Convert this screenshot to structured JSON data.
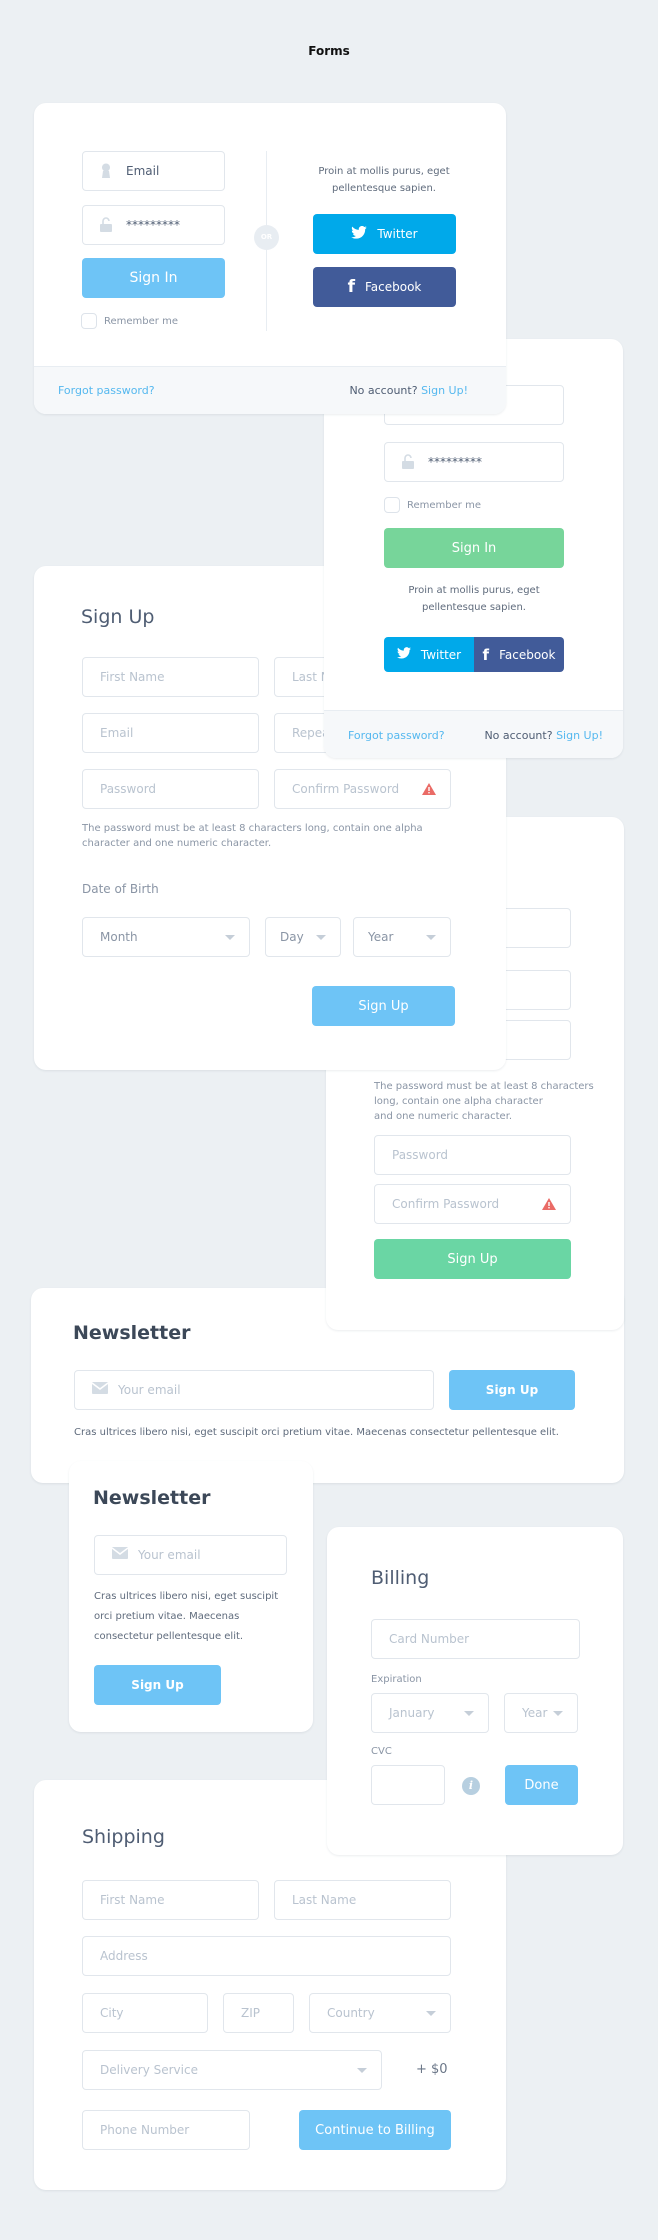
{
  "page": {
    "title": "Forms"
  },
  "colors": {
    "accent_blue": "#6ec4f6",
    "green": "#77d59a",
    "twitter": "#00a9ea",
    "facebook": "#415b99",
    "link": "#55b8ef",
    "warning": "#ea6b66"
  },
  "login_wide": {
    "email_value": "Email",
    "password_value": "*********",
    "sign_in": "Sign In",
    "remember_me": "Remember me",
    "or": "OR",
    "social_text": "Proin at mollis purus, eget pellentesque sapien.",
    "twitter": "Twitter",
    "facebook": "Facebook",
    "forgot": "Forgot password?",
    "no_account": "No account?",
    "sign_up_link": "Sign Up!"
  },
  "login_narrow": {
    "password_value": "*********",
    "remember_me": "Remember me",
    "sign_in": "Sign In",
    "social_text": "Proin at mollis purus, eget pellentesque sapien.",
    "twitter": "Twitter",
    "facebook": "Facebook",
    "forgot": "Forgot password?",
    "no_account": "No account?",
    "sign_up_link": "Sign Up!"
  },
  "signup_wide": {
    "title": "Sign Up",
    "first_name": "First Name",
    "last_name": "Last Name",
    "email": "Email",
    "repeat_email": "Repeat Email",
    "password": "Password",
    "confirm_password": "Confirm Password",
    "hint": "The password must be at least 8 characters long, contain one alpha character and one numeric character.",
    "dob_label": "Date of Birth",
    "month": "Month",
    "day": "Day",
    "year": "Year",
    "submit": "Sign Up"
  },
  "signup_narrow": {
    "hint_line1": "The password must be at least 8 characters",
    "hint_line2": "long, contain one alpha character",
    "hint_line3": "and one numeric character.",
    "password": "Password",
    "confirm_password": "Confirm Password",
    "submit": "Sign Up"
  },
  "newsletter_wide": {
    "title": "Newsletter",
    "placeholder": "Your email",
    "submit": "Sign Up",
    "description": "Cras ultrices libero nisi, eget suscipit orci pretium vitae. Maecenas consectetur pellentesque elit."
  },
  "newsletter_narrow": {
    "title": "Newsletter",
    "placeholder": "Your email",
    "description": "Cras ultrices libero nisi, eget suscipit orci pretium vitae. Maecenas consectetur pellentesque elit.",
    "submit": "Sign Up"
  },
  "billing": {
    "title": "Billing",
    "card_number": "Card Number",
    "expiration_label": "Expiration",
    "month": "January",
    "year": "Year",
    "cvc_label": "CVC",
    "done": "Done"
  },
  "shipping": {
    "title": "Shipping",
    "first_name": "First Name",
    "last_name": "Last Name",
    "address": "Address",
    "city": "City",
    "zip": "ZIP",
    "country": "Country",
    "delivery": "Delivery Service",
    "delivery_price": "+ $0",
    "phone": "Phone Number",
    "continue": "Continue to Billing"
  }
}
